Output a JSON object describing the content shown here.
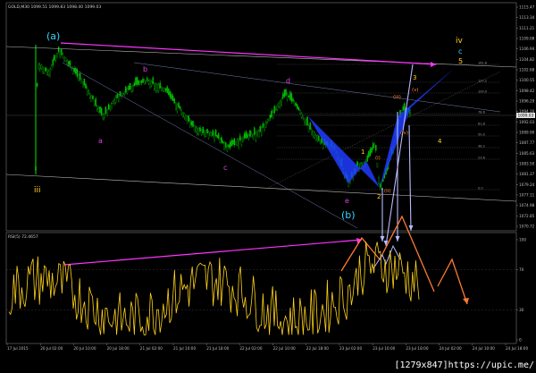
{
  "instrument": {
    "symbol_label": "GOLD,M30",
    "quote": "1099.51 1099.83 1098.40 1099.03"
  },
  "indicator": {
    "label": "RSI(5) 72.4657"
  },
  "price_axis": {
    "ticks": [
      "1115.47",
      "1113.34",
      "1111.21",
      "1109.08",
      "1106.94",
      "1104.82",
      "1102.68",
      "1100.55",
      "1098.42",
      "1096.29",
      "1094.16",
      "1092.03",
      "1089.90",
      "1087.77",
      "1085.63",
      "1083.50",
      "1081.37",
      "1079.24",
      "1077.11",
      "1074.98",
      "1072.85",
      "1070.72"
    ],
    "current_price": "1099.03"
  },
  "rsi_axis": {
    "ticks": [
      "100",
      "70",
      "30",
      "0"
    ]
  },
  "time_axis": {
    "ticks": [
      "17 Jul 2015",
      "20 Jul 02:00",
      "20 Jul 10:00",
      "20 Jul 18:00",
      "21 Jul 02:00",
      "21 Jul 10:00",
      "21 Jul 18:00",
      "22 Jul 02:00",
      "22 Jul 10:00",
      "22 Jul 18:00",
      "23 Jul 02:00",
      "23 Jul 10:00",
      "23 Jul 18:00",
      "24 Jul 02:00",
      "24 Jul 10:00",
      "24 Jul 18:00"
    ]
  },
  "wave_labels": {
    "a_paren": "(a)",
    "b_paren": "(b)",
    "iii": "iii",
    "iv": "iv",
    "c": "c",
    "five": "5",
    "a": "a",
    "b": "b",
    "c_small": "c",
    "d": "d",
    "e": "e",
    "one": "1",
    "two": "2",
    "three": "3",
    "four": "4",
    "i_paren": "(i)",
    "ii_paren": "(ii)",
    "iii_paren": "(iii)",
    "iv_paren": "(iv)",
    "v_paren": "(v)"
  },
  "fib_labels": [
    "161.8",
    "127.2",
    "100.0",
    "78.6",
    "61.8",
    "50.0",
    "38.2",
    "23.6",
    "0.0"
  ],
  "colors": {
    "candle_up": "#00c000",
    "candle_down": "#00c000",
    "rsi_line": "#ffd21a",
    "magenta": "#ff33ff",
    "pattern_blue": "#1f3cff",
    "orange": "#ff7a33",
    "lavender": "#b9b9ff",
    "cyan": "#33d6ff",
    "yellow_label": "#ffd21a"
  },
  "watermark": "[1279x847]https://upic.me/"
}
